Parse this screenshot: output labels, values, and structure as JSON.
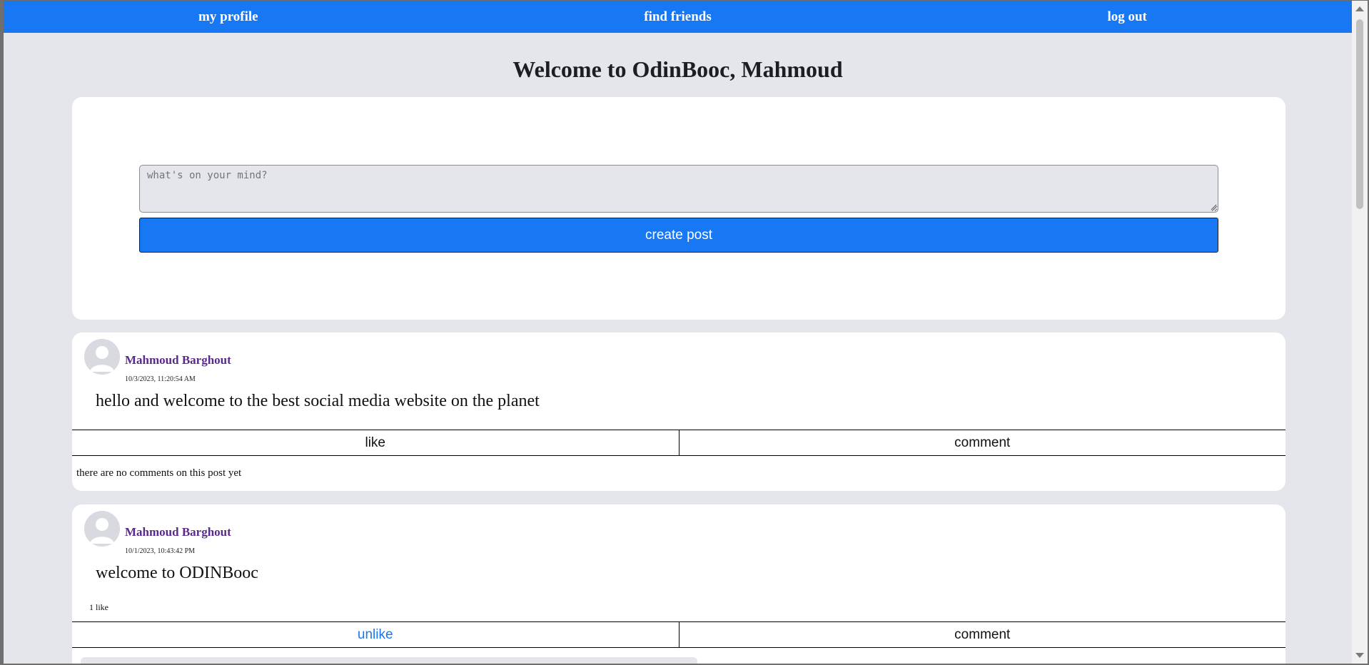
{
  "nav": {
    "my_profile": "my profile",
    "find_friends": "find friends",
    "log_out": "log out"
  },
  "page_title": "Welcome to OdinBooc, Mahmoud",
  "composer": {
    "placeholder": "what's on your mind?",
    "submit_label": "create post"
  },
  "posts": [
    {
      "author": "Mahmoud Barghout",
      "timestamp": "10/3/2023, 11:20:54 AM",
      "body": "hello and welcome to the best social media website on the planet",
      "like_label": "like",
      "comment_label": "comment",
      "comments_text": "there are no comments on this post yet"
    },
    {
      "author": "Mahmoud Barghout",
      "timestamp": "10/1/2023, 10:43:42 PM",
      "body": "welcome to ODINBooc",
      "likes_count": "1 like",
      "like_label": "unlike",
      "comment_label": "comment"
    }
  ],
  "colors": {
    "brand": "#1877f2",
    "page_bg": "#e4e6eb",
    "author": "#5a2a8a"
  }
}
